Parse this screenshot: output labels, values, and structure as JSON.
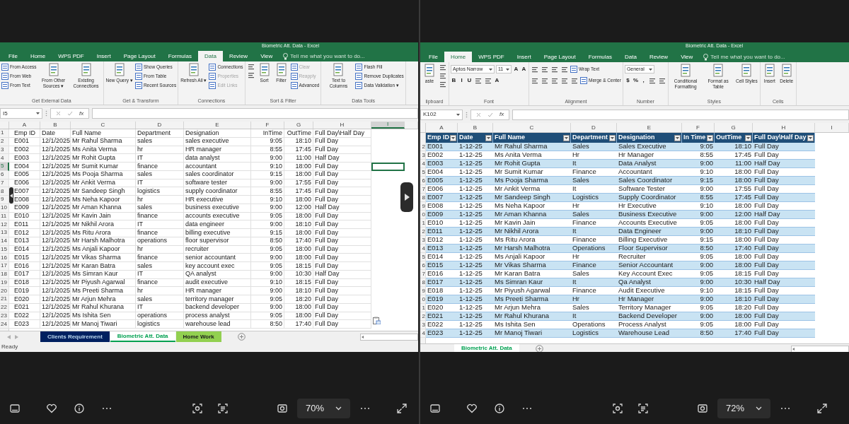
{
  "windows": [
    {
      "kind": "plain",
      "title": "Biometric Att. Data - Excel",
      "menu_tabs": [
        {
          "label": "File",
          "selected": false
        },
        {
          "label": "Home",
          "selected": false
        },
        {
          "label": "WPS PDF",
          "selected": false
        },
        {
          "label": "Insert",
          "selected": false
        },
        {
          "label": "Page Layout",
          "selected": false
        },
        {
          "label": "Formulas",
          "selected": false
        },
        {
          "label": "Data",
          "selected": true
        },
        {
          "label": "Review",
          "selected": false
        },
        {
          "label": "View",
          "selected": false
        }
      ],
      "tell_me": "Tell me what you want to do...",
      "ribbon": [
        {
          "label": "Get External Data",
          "items": [
            {
              "kind": "small",
              "label": "From Access",
              "disabled": false
            },
            {
              "kind": "small",
              "label": "From Web",
              "disabled": false
            },
            {
              "kind": "small",
              "label": "From Text",
              "disabled": false
            },
            {
              "kind": "large",
              "label": "From Other Sources ▾",
              "disabled": false
            },
            {
              "kind": "large",
              "label": "Existing Connections",
              "disabled": false
            }
          ]
        },
        {
          "label": "Get & Transform",
          "items": [
            {
              "kind": "large",
              "label": "New Query ▾",
              "disabled": false
            },
            {
              "kind": "small",
              "label": "Show Queries",
              "disabled": false
            },
            {
              "kind": "small",
              "label": "From Table",
              "disabled": false
            },
            {
              "kind": "small",
              "label": "Recent Sources",
              "disabled": false
            }
          ]
        },
        {
          "label": "Connections",
          "items": [
            {
              "kind": "large",
              "label": "Refresh All ▾",
              "disabled": false
            },
            {
              "kind": "small",
              "label": "Connections",
              "disabled": false
            },
            {
              "kind": "small",
              "label": "Properties",
              "disabled": true
            },
            {
              "kind": "small",
              "label": "Edit Links",
              "disabled": true
            }
          ]
        },
        {
          "label": "Sort & Filter",
          "items": [
            {
              "kind": "icon"
            },
            {
              "kind": "icon"
            },
            {
              "kind": "large",
              "label": "Sort",
              "disabled": false
            },
            {
              "kind": "large",
              "label": "Filter",
              "disabled": false
            },
            {
              "kind": "small",
              "label": "Clear",
              "disabled": true
            },
            {
              "kind": "small",
              "label": "Reapply",
              "disabled": true
            },
            {
              "kind": "small",
              "label": "Advanced",
              "disabled": false
            }
          ]
        },
        {
          "label": "Data Tools",
          "items": [
            {
              "kind": "large",
              "label": "Text to Columns",
              "disabled": false
            },
            {
              "kind": "small",
              "label": "Flash Fill",
              "disabled": false
            },
            {
              "kind": "small",
              "label": "Remove Duplicates",
              "disabled": false
            },
            {
              "kind": "small",
              "label": "Data Validation ▾",
              "disabled": false
            }
          ]
        }
      ],
      "name_box": "I5",
      "function_button": "fx",
      "columns": [
        {
          "label": "A",
          "selected": false
        },
        {
          "label": "B",
          "selected": false
        },
        {
          "label": "C",
          "selected": false
        },
        {
          "label": "D",
          "selected": false
        },
        {
          "label": "E",
          "selected": false
        },
        {
          "label": "F",
          "selected": false
        },
        {
          "label": "G",
          "selected": false
        },
        {
          "label": "H",
          "selected": false
        },
        {
          "label": "I",
          "selected": true
        }
      ],
      "header_row": {
        "header": "1",
        "selected": false,
        "cells": [
          "Emp ID",
          "Date",
          "Full Name",
          "Department",
          "Designation",
          "InTime",
          "OutTime",
          "Full Day\\Half Day"
        ]
      },
      "rows": [
        {
          "header": "2",
          "selected": false,
          "cells": [
            "E001",
            "12/1/2025",
            "Mr Rahul Sharma",
            "sales",
            "sales executive",
            "9:05",
            "18:10",
            "Full Day"
          ]
        },
        {
          "header": "3",
          "selected": false,
          "cells": [
            "E002",
            "12/1/2025",
            "Ms Anita Verma",
            "hr",
            "HR manager",
            "8:55",
            "17:45",
            "Full Day"
          ]
        },
        {
          "header": "4",
          "selected": false,
          "cells": [
            "E003",
            "12/1/2025",
            "Mr Rohit Gupta",
            "IT",
            "data analyst",
            "9:00",
            "11:00",
            "Half Day"
          ]
        },
        {
          "header": "5",
          "selected": true,
          "cells": [
            "E004",
            "12/1/2025",
            "Mr Sumit Kumar",
            "finance",
            "accountant",
            "9:10",
            "18:00",
            "Full Day"
          ]
        },
        {
          "header": "6",
          "selected": false,
          "cells": [
            "E005",
            "12/1/2025",
            "Ms Pooja Sharma",
            "sales",
            "sales coordinator",
            "9:15",
            "18:00",
            "Full Day"
          ]
        },
        {
          "header": "7",
          "selected": false,
          "cells": [
            "E006",
            "12/1/2025",
            "Mr Ankit Verma",
            "IT",
            "software tester",
            "9:00",
            "17:55",
            "Full Day"
          ]
        },
        {
          "header": "8",
          "selected": false,
          "cells": [
            "E007",
            "12/1/2025",
            "Mr Sandeep Singh",
            "logistics",
            "supply coordinator",
            "8:55",
            "17:45",
            "Full Day"
          ]
        },
        {
          "header": "9",
          "selected": false,
          "cells": [
            "E008",
            "12/1/2025",
            "Ms Neha Kapoor",
            "hr",
            "HR executive",
            "9:10",
            "18:00",
            "Full Day"
          ]
        },
        {
          "header": "10",
          "selected": false,
          "cells": [
            "E009",
            "12/1/2025",
            "Mr Aman Khanna",
            "sales",
            "business executive",
            "9:00",
            "12:00",
            "Half Day"
          ]
        },
        {
          "header": "11",
          "selected": false,
          "cells": [
            "E010",
            "12/1/2025",
            "Mr Kavin Jain",
            "finance",
            "accounts executive",
            "9:05",
            "18:00",
            "Full Day"
          ]
        },
        {
          "header": "12",
          "selected": false,
          "cells": [
            "E011",
            "12/1/2025",
            "Mr Nikhil Arora",
            "IT",
            "data engineer",
            "9:00",
            "18:10",
            "Full Day"
          ]
        },
        {
          "header": "13",
          "selected": false,
          "cells": [
            "E012",
            "12/1/2025",
            "Ms Ritu Arora",
            "finance",
            "billing executive",
            "9:15",
            "18:00",
            "Full Day"
          ]
        },
        {
          "header": "14",
          "selected": false,
          "cells": [
            "E013",
            "12/1/2025",
            "Mr Harsh Malhotra",
            "operations",
            "floor supervisor",
            "8:50",
            "17:40",
            "Full Day"
          ]
        },
        {
          "header": "15",
          "selected": false,
          "cells": [
            "E014",
            "12/1/2025",
            "Ms Anjali Kapoor",
            "hr",
            "recruiter",
            "9:05",
            "18:00",
            "Full Day"
          ]
        },
        {
          "header": "16",
          "selected": false,
          "cells": [
            "E015",
            "12/1/2025",
            "Mr Vikas Sharma",
            "finance",
            "senior accountant",
            "9:00",
            "18:00",
            "Full Day"
          ]
        },
        {
          "header": "17",
          "selected": false,
          "cells": [
            "E016",
            "12/1/2025",
            "Mr Karan Batra",
            "sales",
            "key account exec",
            "9:05",
            "18:15",
            "Full Day"
          ]
        },
        {
          "header": "18",
          "selected": false,
          "cells": [
            "E017",
            "12/1/2025",
            "Ms Simran Kaur",
            "IT",
            "QA analyst",
            "9:00",
            "10:30",
            "Half Day"
          ]
        },
        {
          "header": "19",
          "selected": false,
          "cells": [
            "E018",
            "12/1/2025",
            "Mr Piyush Agarwal",
            "finance",
            "audit executive",
            "9:10",
            "18:15",
            "Full Day"
          ]
        },
        {
          "header": "20",
          "selected": false,
          "cells": [
            "E019",
            "12/1/2025",
            "Ms Preeti Sharma",
            "hr",
            "HR manager",
            "9:00",
            "18:10",
            "Full Day"
          ]
        },
        {
          "header": "21",
          "selected": false,
          "cells": [
            "E020",
            "12/1/2025",
            "Mr Arjun Mehra",
            "sales",
            "territory manager",
            "9:05",
            "18:20",
            "Full Day"
          ]
        },
        {
          "header": "22",
          "selected": false,
          "cells": [
            "E021",
            "12/1/2025",
            "Mr Rahul Khurana",
            "IT",
            "backend developer",
            "9:00",
            "18:00",
            "Full Day"
          ]
        },
        {
          "header": "23",
          "selected": false,
          "cells": [
            "E022",
            "12/1/2025",
            "Ms Ishita Sen",
            "operations",
            "process analyst",
            "9:05",
            "18:00",
            "Full Day"
          ]
        },
        {
          "header": "24",
          "selected": false,
          "cells": [
            "E023",
            "12/1/2025",
            "Mr Manoj Tiwari",
            "logistics",
            "warehouse lead",
            "8:50",
            "17:40",
            "Full Day"
          ]
        }
      ],
      "sheet_tabs": [
        {
          "label": "Clients Requirement",
          "selected": false,
          "color": "#002060"
        },
        {
          "label": "Biometric Att. Data",
          "selected": true,
          "color": "#00a050"
        },
        {
          "label": "Home Work",
          "selected": false,
          "color": "#92d050"
        }
      ],
      "status": "Ready"
    },
    {
      "kind": "table",
      "title": "Biometric Att. Data - Excel",
      "menu_tabs": [
        {
          "label": "File",
          "selected": false
        },
        {
          "label": "Home",
          "selected": true
        },
        {
          "label": "WPS PDF",
          "selected": false
        },
        {
          "label": "Insert",
          "selected": false
        },
        {
          "label": "Page Layout",
          "selected": false
        },
        {
          "label": "Formulas",
          "selected": false
        },
        {
          "label": "Data",
          "selected": false
        },
        {
          "label": "Review",
          "selected": false
        },
        {
          "label": "View",
          "selected": false
        }
      ],
      "tell_me": "Tell me what you want to do...",
      "ribbon": [
        {
          "label": "lipboard",
          "items": [
            {
              "kind": "large",
              "label": "aste",
              "disabled": false
            },
            {
              "kind": "icon"
            },
            {
              "kind": "icon"
            },
            {
              "kind": "icon"
            }
          ]
        },
        {
          "label": "Font",
          "lines": [
            [
              {
                "kind": "field",
                "value": "Aptos Narrow"
              },
              {
                "kind": "field",
                "value": "11"
              },
              {
                "kind": "text",
                "label": "A"
              },
              {
                "kind": "text",
                "label": "A"
              }
            ],
            [
              {
                "kind": "text",
                "label": "B"
              },
              {
                "kind": "text",
                "label": "I"
              },
              {
                "kind": "text",
                "label": "U"
              },
              {
                "kind": "icon"
              },
              {
                "kind": "icon"
              },
              {
                "kind": "text",
                "label": "A"
              }
            ]
          ]
        },
        {
          "label": "Alignment",
          "lines": [
            [
              {
                "kind": "icon"
              },
              {
                "kind": "icon"
              },
              {
                "kind": "icon"
              },
              {
                "kind": "icon"
              },
              {
                "kind": "small",
                "label": "Wrap Text",
                "disabled": false
              }
            ],
            [
              {
                "kind": "icon"
              },
              {
                "kind": "icon"
              },
              {
                "kind": "icon"
              },
              {
                "kind": "icon"
              },
              {
                "kind": "icon"
              },
              {
                "kind": "small",
                "label": "Merge & Center",
                "disabled": false
              }
            ]
          ]
        },
        {
          "label": "Number",
          "lines": [
            [
              {
                "kind": "field",
                "value": "General"
              }
            ],
            [
              {
                "kind": "text",
                "label": "$"
              },
              {
                "kind": "text",
                "label": "%"
              },
              {
                "kind": "text",
                "label": ","
              },
              {
                "kind": "icon"
              },
              {
                "kind": "icon"
              }
            ]
          ]
        },
        {
          "label": "Styles",
          "items": [
            {
              "kind": "large",
              "label": "Conditional Formatting",
              "disabled": false
            },
            {
              "kind": "large",
              "label": "Format as Table",
              "disabled": false
            },
            {
              "kind": "large",
              "label": "Cell Styles",
              "disabled": false
            }
          ]
        },
        {
          "label": "Cells",
          "items": [
            {
              "kind": "large",
              "label": "Insert",
              "disabled": false
            },
            {
              "kind": "large",
              "label": "Delete",
              "disabled": false
            }
          ]
        }
      ],
      "name_box": "K102",
      "function_button": "fx",
      "columns": [
        {
          "label": "A",
          "selected": false
        },
        {
          "label": "B",
          "selected": false
        },
        {
          "label": "C",
          "selected": false
        },
        {
          "label": "D",
          "selected": false
        },
        {
          "label": "E",
          "selected": false
        },
        {
          "label": "F",
          "selected": false
        },
        {
          "label": "G",
          "selected": false
        },
        {
          "label": "H",
          "selected": false
        },
        {
          "label": "I",
          "selected": false
        }
      ],
      "header_row": {
        "selected": false,
        "cells": [
          "Emp ID",
          "Date",
          "Full Name",
          "Department",
          "Designation",
          "In Time",
          "OutTime",
          "Full Day\\Half Day"
        ]
      },
      "rows": [
        {
          "header": "2",
          "selected": false,
          "cells": [
            "E001",
            "1-12-25",
            "Mr Rahul Sharma",
            "Sales",
            "Sales Executive",
            "9:05",
            "18:10",
            "Full Day"
          ]
        },
        {
          "header": "3",
          "selected": false,
          "cells": [
            "E002",
            "1-12-25",
            "Ms Anita Verma",
            "Hr",
            "Hr Manager",
            "8:55",
            "17:45",
            "Full Day"
          ]
        },
        {
          "header": "4",
          "selected": false,
          "cells": [
            "E003",
            "1-12-25",
            "Mr Rohit Gupta",
            "It",
            "Data Analyst",
            "9:00",
            "11:00",
            "Half Day"
          ]
        },
        {
          "header": "5",
          "selected": false,
          "cells": [
            "E004",
            "1-12-25",
            "Mr Sumit Kumar",
            "Finance",
            "Accountant",
            "9:10",
            "18:00",
            "Full Day"
          ]
        },
        {
          "header": "6",
          "selected": false,
          "cells": [
            "E005",
            "1-12-25",
            "Ms Pooja Sharma",
            "Sales",
            "Sales Coordinator",
            "9:15",
            "18:00",
            "Full Day"
          ]
        },
        {
          "header": "7",
          "selected": false,
          "cells": [
            "E006",
            "1-12-25",
            "Mr Ankit Verma",
            "It",
            "Software Tester",
            "9:00",
            "17:55",
            "Full Day"
          ]
        },
        {
          "header": "8",
          "selected": false,
          "cells": [
            "E007",
            "1-12-25",
            "Mr Sandeep Singh",
            "Logistics",
            "Supply Coordinator",
            "8:55",
            "17:45",
            "Full Day"
          ]
        },
        {
          "header": "9",
          "selected": false,
          "cells": [
            "E008",
            "1-12-25",
            "Ms Neha Kapoor",
            "Hr",
            "Hr Executive",
            "9:10",
            "18:00",
            "Full Day"
          ]
        },
        {
          "header": "0",
          "selected": false,
          "cells": [
            "E009",
            "1-12-25",
            "Mr Aman Khanna",
            "Sales",
            "Business Executive",
            "9:00",
            "12:00",
            "Half Day"
          ]
        },
        {
          "header": "1",
          "selected": false,
          "cells": [
            "E010",
            "1-12-25",
            "Mr Kavin Jain",
            "Finance",
            "Accounts Executive",
            "9:05",
            "18:00",
            "Full Day"
          ]
        },
        {
          "header": "2",
          "selected": false,
          "cells": [
            "E011",
            "1-12-25",
            "Mr Nikhil Arora",
            "It",
            "Data Engineer",
            "9:00",
            "18:10",
            "Full Day"
          ]
        },
        {
          "header": "3",
          "selected": false,
          "cells": [
            "E012",
            "1-12-25",
            "Ms Ritu Arora",
            "Finance",
            "Billing Executive",
            "9:15",
            "18:00",
            "Full Day"
          ]
        },
        {
          "header": "4",
          "selected": false,
          "cells": [
            "E013",
            "1-12-25",
            "Mr Harsh Malhotra",
            "Operations",
            "Floor Supervisor",
            "8:50",
            "17:40",
            "Full Day"
          ]
        },
        {
          "header": "5",
          "selected": false,
          "cells": [
            "E014",
            "1-12-25",
            "Ms Anjali Kapoor",
            "Hr",
            "Recruiter",
            "9:05",
            "18:00",
            "Full Day"
          ]
        },
        {
          "header": "6",
          "selected": false,
          "cells": [
            "E015",
            "1-12-25",
            "Mr Vikas Sharma",
            "Finance",
            "Senior Accountant",
            "9:00",
            "18:00",
            "Full Day"
          ]
        },
        {
          "header": "7",
          "selected": false,
          "cells": [
            "E016",
            "1-12-25",
            "Mr Karan Batra",
            "Sales",
            "Key Account Exec",
            "9:05",
            "18:15",
            "Full Day"
          ]
        },
        {
          "header": "8",
          "selected": false,
          "cells": [
            "E017",
            "1-12-25",
            "Ms Simran Kaur",
            "It",
            "Qa Analyst",
            "9:00",
            "10:30",
            "Half Day"
          ]
        },
        {
          "header": "9",
          "selected": false,
          "cells": [
            "E018",
            "1-12-25",
            "Mr Piyush Agarwal",
            "Finance",
            "Audit Executive",
            "9:10",
            "18:15",
            "Full Day"
          ]
        },
        {
          "header": "0",
          "selected": false,
          "cells": [
            "E019",
            "1-12-25",
            "Ms Preeti Sharma",
            "Hr",
            "Hr Manager",
            "9:00",
            "18:10",
            "Full Day"
          ]
        },
        {
          "header": "1",
          "selected": false,
          "cells": [
            "E020",
            "1-12-25",
            "Mr Arjun Mehra",
            "Sales",
            "Territory Manager",
            "9:05",
            "18:20",
            "Full Day"
          ]
        },
        {
          "header": "2",
          "selected": false,
          "cells": [
            "E021",
            "1-12-25",
            "Mr Rahul Khurana",
            "It",
            "Backend Developer",
            "9:00",
            "18:00",
            "Full Day"
          ]
        },
        {
          "header": "3",
          "selected": false,
          "cells": [
            "E022",
            "1-12-25",
            "Ms Ishita Sen",
            "Operations",
            "Process Analyst",
            "9:05",
            "18:00",
            "Full Day"
          ]
        },
        {
          "header": "4",
          "selected": false,
          "cells": [
            "E023",
            "1-12-25",
            "Mr Manoj Tiwari",
            "Logistics",
            "Warehouse Lead",
            "8:50",
            "17:40",
            "Full Day"
          ]
        }
      ],
      "sheet_tabs": [
        {
          "label": "Biometric Att. Data",
          "selected": true,
          "color": "#00a050"
        }
      ]
    }
  ],
  "viewer_bars": [
    {
      "zoom": "70%"
    },
    {
      "zoom": "72%"
    }
  ]
}
